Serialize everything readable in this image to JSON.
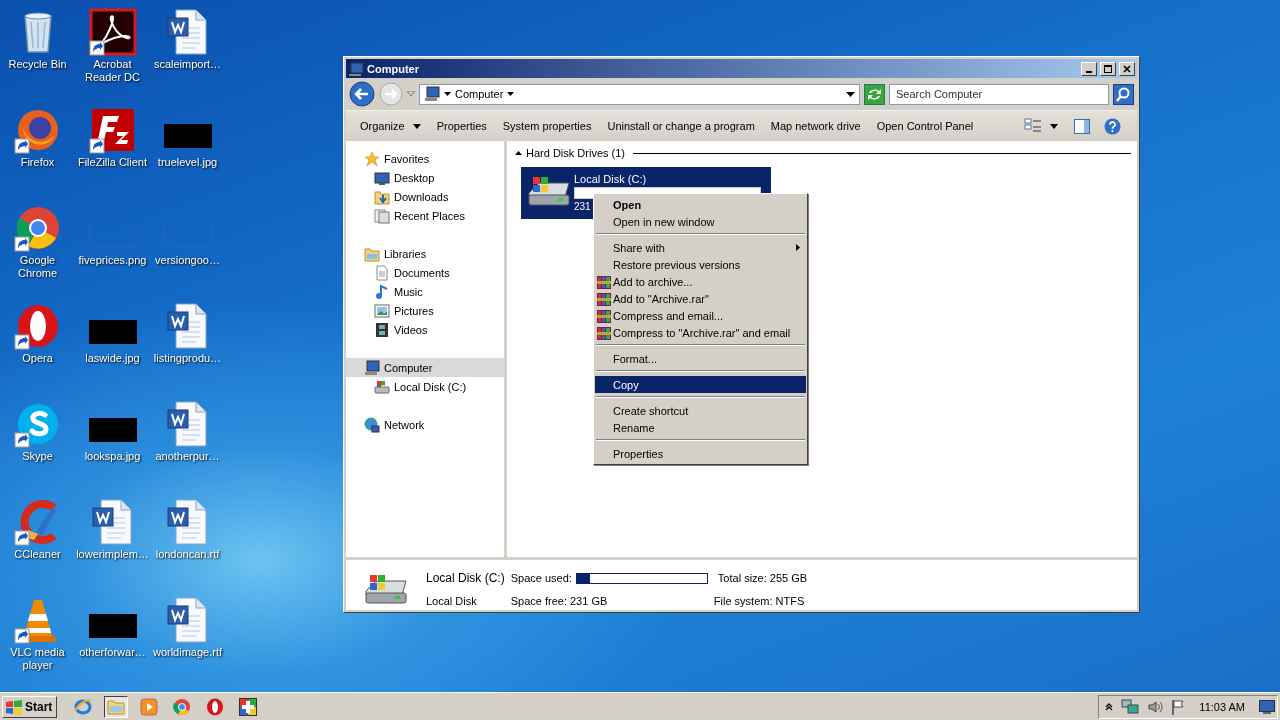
{
  "desktop_icons": [
    {
      "label": "Recycle Bin",
      "kind": "recycle",
      "shortcut": false
    },
    {
      "label": "Acrobat Reader DC",
      "kind": "pdf",
      "shortcut": true
    },
    {
      "label": "scaleimport…",
      "kind": "word",
      "shortcut": false
    },
    {
      "label": "Firefox",
      "kind": "firefox",
      "shortcut": true
    },
    {
      "label": "FileZilla Client",
      "kind": "filezilla",
      "shortcut": true
    },
    {
      "label": "truelevel.jpg",
      "kind": "redacted",
      "shortcut": false
    },
    {
      "label": "Google Chrome",
      "kind": "chrome",
      "shortcut": true
    },
    {
      "label": "fiveprices.png",
      "kind": "blank",
      "shortcut": false
    },
    {
      "label": "versiongoo…",
      "kind": "blank",
      "shortcut": false
    },
    {
      "label": "Opera",
      "kind": "opera",
      "shortcut": true
    },
    {
      "label": "laswide.jpg",
      "kind": "redacted",
      "shortcut": false
    },
    {
      "label": "listingprodu…",
      "kind": "word",
      "shortcut": false
    },
    {
      "label": "Skype",
      "kind": "skype",
      "shortcut": true
    },
    {
      "label": "lookspa.jpg",
      "kind": "redacted",
      "shortcut": false
    },
    {
      "label": "anotherpur…",
      "kind": "word",
      "shortcut": false
    },
    {
      "label": "CCleaner",
      "kind": "ccleaner",
      "shortcut": true
    },
    {
      "label": "lowerimplem…",
      "kind": "word",
      "shortcut": false
    },
    {
      "label": "londoncan.rtf",
      "kind": "word",
      "shortcut": false
    },
    {
      "label": "VLC media player",
      "kind": "vlc",
      "shortcut": true
    },
    {
      "label": "otherforwar…",
      "kind": "redacted",
      "shortcut": false
    },
    {
      "label": "worldimage.rtf",
      "kind": "word",
      "shortcut": false
    }
  ],
  "window": {
    "title": "Computer",
    "address": "Computer",
    "search": {
      "placeholder": "Search Computer"
    },
    "toolbar": [
      {
        "label": "Organize",
        "dropdown": true
      },
      {
        "label": "Properties",
        "dropdown": false
      },
      {
        "label": "System properties",
        "dropdown": false
      },
      {
        "label": "Uninstall or change a program",
        "dropdown": false
      },
      {
        "label": "Map network drive",
        "dropdown": false
      },
      {
        "label": "Open Control Panel",
        "dropdown": false
      }
    ],
    "nav": [
      {
        "label": "Favorites",
        "selected": false,
        "children": [
          {
            "label": "Desktop",
            "selected": false
          },
          {
            "label": "Downloads",
            "selected": false
          },
          {
            "label": "Recent Places",
            "selected": false
          }
        ]
      },
      {
        "label": "Libraries",
        "selected": false,
        "children": [
          {
            "label": "Documents",
            "selected": false
          },
          {
            "label": "Music",
            "selected": false
          },
          {
            "label": "Pictures",
            "selected": false
          },
          {
            "label": "Videos",
            "selected": false
          }
        ]
      },
      {
        "label": "Computer",
        "selected": true,
        "children": [
          {
            "label": "Local Disk (C:)",
            "selected": false
          }
        ]
      },
      {
        "label": "Network",
        "selected": false
      }
    ],
    "group": {
      "title": "Hard Disk Drives (1)",
      "expanded": true
    },
    "drive": {
      "name": "Local Disk (C:)",
      "free": "231",
      "selected": true
    },
    "details": {
      "name": "Local Disk (C:)",
      "type": "Local Disk",
      "used_label": "Space used:",
      "level": 0.1,
      "free": "Space free: 231 GB",
      "total": "Total size: 255 GB",
      "filesystem": "File system: NTFS"
    }
  },
  "context_menu": [
    {
      "kind": "item",
      "label": "Open",
      "default": true,
      "selected": false,
      "submenu": false,
      "icon": false
    },
    {
      "kind": "item",
      "label": "Open in new window",
      "default": false,
      "selected": false,
      "submenu": false,
      "icon": false
    },
    {
      "kind": "separator"
    },
    {
      "kind": "item",
      "label": "Share with",
      "default": false,
      "selected": false,
      "submenu": true,
      "icon": false
    },
    {
      "kind": "item",
      "label": "Restore previous versions",
      "default": false,
      "selected": false,
      "submenu": false,
      "icon": false
    },
    {
      "kind": "item",
      "label": "Add to archive...",
      "default": false,
      "selected": false,
      "submenu": false,
      "icon": true
    },
    {
      "kind": "item",
      "label": "Add to \"Archive.rar\"",
      "default": false,
      "selected": false,
      "submenu": false,
      "icon": true
    },
    {
      "kind": "item",
      "label": "Compress and email...",
      "default": false,
      "selected": false,
      "submenu": false,
      "icon": true
    },
    {
      "kind": "item",
      "label": "Compress to \"Archive.rar\" and email",
      "default": false,
      "selected": false,
      "submenu": false,
      "icon": true
    },
    {
      "kind": "separator"
    },
    {
      "kind": "item",
      "label": "Format...",
      "default": false,
      "selected": false,
      "submenu": false,
      "icon": false
    },
    {
      "kind": "separator"
    },
    {
      "kind": "item",
      "label": "Copy",
      "default": false,
      "selected": true,
      "submenu": false,
      "icon": false
    },
    {
      "kind": "separator"
    },
    {
      "kind": "item",
      "label": "Create shortcut",
      "default": false,
      "selected": false,
      "submenu": false,
      "icon": false
    },
    {
      "kind": "item",
      "label": "Rename",
      "default": false,
      "selected": false,
      "submenu": false,
      "icon": false
    },
    {
      "kind": "separator"
    },
    {
      "kind": "item",
      "label": "Properties",
      "default": false,
      "selected": false,
      "submenu": false,
      "icon": false
    }
  ],
  "taskbar": {
    "start": "Start",
    "apps": [
      {
        "kind": "ie",
        "active": false
      },
      {
        "kind": "explorer",
        "active": true
      },
      {
        "kind": "media",
        "active": false
      },
      {
        "kind": "chrome",
        "active": false
      },
      {
        "kind": "opera",
        "active": false
      },
      {
        "kind": "cross",
        "active": false
      }
    ],
    "clock": "11:03 AM"
  }
}
